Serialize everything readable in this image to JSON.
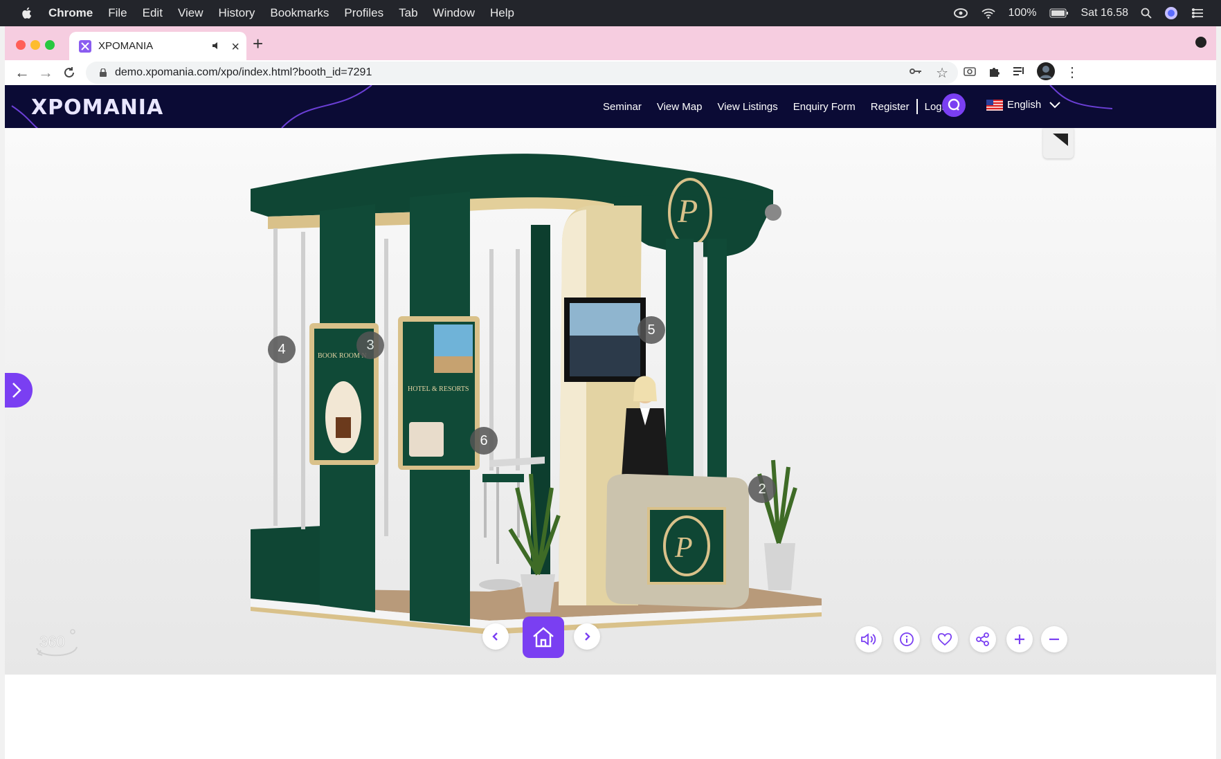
{
  "os_menubar": {
    "app": "Chrome",
    "menus": [
      "File",
      "Edit",
      "View",
      "History",
      "Bookmarks",
      "Profiles",
      "Tab",
      "Window",
      "Help"
    ],
    "battery": "100%",
    "clock": "Sat 16.58"
  },
  "browser": {
    "tab_title": "XPOMANIA",
    "url": "demo.xpomania.com/xpo/index.html?booth_id=7291"
  },
  "site": {
    "logo": "XPOMANIA",
    "nav": [
      "Seminar",
      "View Map",
      "View Listings",
      "Enquiry Form",
      "Register",
      "Login"
    ],
    "language": "English"
  },
  "hotspots": [
    "2",
    "3",
    "4",
    "5",
    "6"
  ],
  "booth": {
    "poster_left_title": "BOOK ROOM N",
    "poster_right_title": "HOTEL & RESORTS"
  },
  "colors": {
    "accent": "#7a3ff2",
    "header_bg": "#0b0b35",
    "booth_green": "#0f4634",
    "booth_gold": "#d9c18a"
  },
  "icons": {
    "three_sixty": "360-view-icon",
    "home": "home-icon",
    "controls": [
      "sound-icon",
      "info-icon",
      "heart-icon",
      "share-icon",
      "plus-icon",
      "minus-icon"
    ]
  }
}
